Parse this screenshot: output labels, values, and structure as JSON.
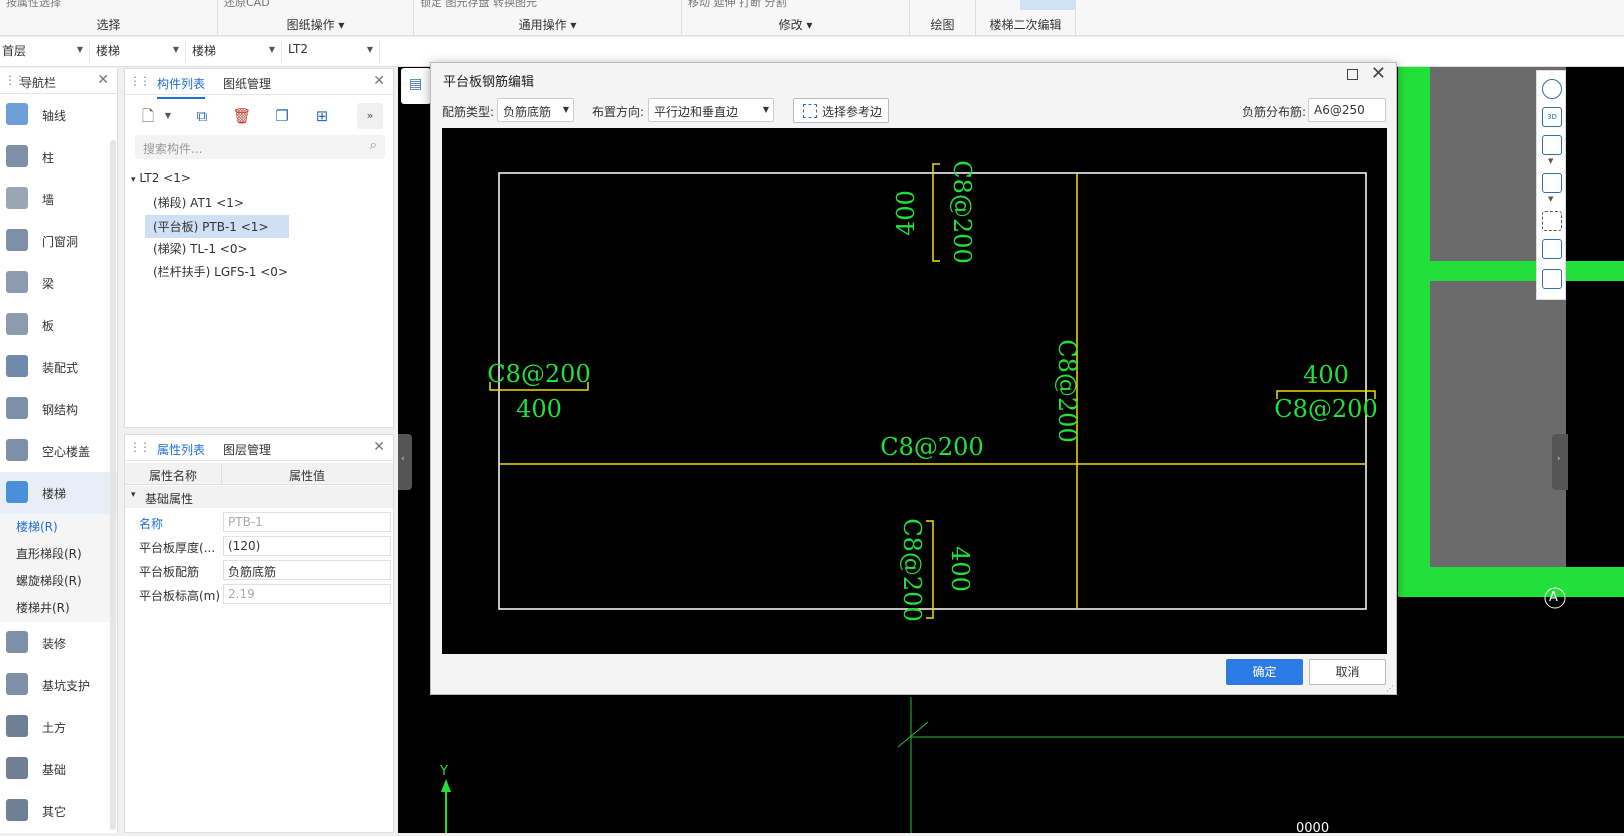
{
  "ribbon": {
    "groups": [
      {
        "label": "选择",
        "top": "按属性选择"
      },
      {
        "label": "图纸操作",
        "top": "还原CAD"
      },
      {
        "label": "通用操作",
        "top": "锁定  图元存盘  转换图元"
      },
      {
        "label": "修改",
        "top": "移动  延伸  打断  分割"
      },
      {
        "label": "绘图",
        "top": ""
      },
      {
        "label": "楼梯二次编辑",
        "top": ""
      }
    ]
  },
  "floorbar": {
    "floor": "首层",
    "type1": "楼梯",
    "type2": "楼梯",
    "name": "LT2"
  },
  "nav": {
    "title": "导航栏",
    "items": [
      {
        "label": "轴线",
        "color": "#6f9fd8"
      },
      {
        "label": "柱",
        "color": "#7e8fa8"
      },
      {
        "label": "墙",
        "color": "#9aa6b4"
      },
      {
        "label": "门窗洞",
        "color": "#7e8fa8"
      },
      {
        "label": "梁",
        "color": "#8c9bb0"
      },
      {
        "label": "板",
        "color": "#8c9bb0"
      },
      {
        "label": "装配式",
        "color": "#6f8aaa"
      },
      {
        "label": "钢结构",
        "color": "#7e8fa8"
      },
      {
        "label": "空心楼盖",
        "color": "#7e8fa8"
      },
      {
        "label": "楼梯",
        "color": "#4a90d9"
      }
    ],
    "subitems": [
      "楼梯(R)",
      "直形梯段(R)",
      "螺旋梯段(R)",
      "楼梯井(R)"
    ],
    "items2": [
      {
        "label": "装修",
        "color": "#7e8fa8"
      },
      {
        "label": "基坑支护",
        "color": "#7e8fa8"
      },
      {
        "label": "土方",
        "color": "#6f7f95"
      },
      {
        "label": "基础",
        "color": "#6f7f95"
      },
      {
        "label": "其它",
        "color": "#6f7f95"
      }
    ]
  },
  "components": {
    "tab1": "构件列表",
    "tab2": "图纸管理",
    "search_placeholder": "搜索构件...",
    "root": "LT2 <1>",
    "children": [
      "(梯段) AT1 <1>",
      "(平台板) PTB-1 <1>",
      "(梯梁) TL-1 <0>",
      "(栏杆扶手) LGFS-1 <0>"
    ]
  },
  "properties": {
    "tab1": "属性列表",
    "tab2": "图层管理",
    "col_name": "属性名称",
    "col_value": "属性值",
    "section": "基础属性",
    "rows": [
      {
        "name": "名称",
        "value": "PTB-1"
      },
      {
        "name": "平台板厚度(...",
        "value": "(120)"
      },
      {
        "name": "平台板配筋",
        "value": "负筋底筋"
      },
      {
        "name": "平台板标高(m)",
        "value": "2.19"
      }
    ]
  },
  "dialog": {
    "title": "平台板钢筋编辑",
    "rebar_type_label": "配筋类型:",
    "rebar_type_value": "负筋底筋",
    "direction_label": "布置方向:",
    "direction_value": "平行边和垂直边",
    "ref_edge_button": "选择参考边",
    "dist_label": "负筋分布筋:",
    "dist_value": "A6@250",
    "ok": "确定",
    "cancel": "取消",
    "rebar_text": "C8@200",
    "dim_text": "400"
  },
  "viewport": {
    "axis_label": "A",
    "y_label": "Y",
    "bottom_text": "0000"
  },
  "colors": {
    "accent": "#1e6fd9",
    "green": "#22e03a",
    "yellow": "#f0e000",
    "cad_green": "#22e03a"
  }
}
